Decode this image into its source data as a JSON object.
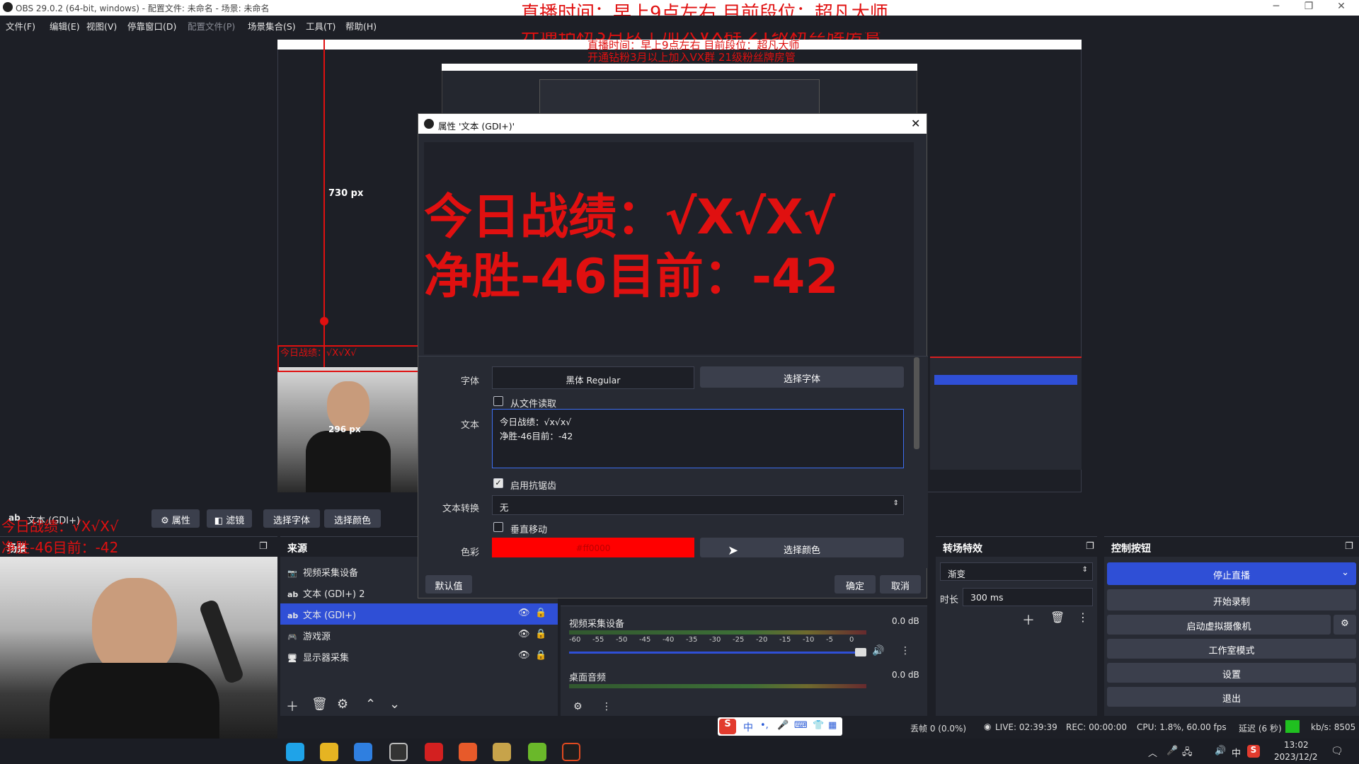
{
  "window": {
    "title": "OBS 29.0.2 (64-bit, windows) - 配置文件: 未命名 - 场景: 未命名",
    "minimize": "─",
    "maximize": "❐",
    "close": "✕"
  },
  "menu": {
    "file": "文件(F)",
    "edit": "编辑(E)",
    "view": "视图(V)",
    "docks": "停靠窗口(D)",
    "profile": "配置文件(P)",
    "scene_collection": "场景集合(S)",
    "tools": "工具(T)",
    "help": "帮助(H)"
  },
  "overlay": {
    "line1": "直播时间：早上9点左右  目前段位：超凡大师",
    "line2": "开通钻粉3月以上加入VX群  21级粉丝牌房管",
    "score_line1": "今日战绩：√X√X√",
    "score_line2": "净胜-46目前：-42"
  },
  "preview": {
    "height_label": "730 px",
    "width_label": "296 px"
  },
  "source_toolbar": {
    "selected_source": "文本 (GDI+)",
    "properties": "属性",
    "filters": "滤镜",
    "select_font": "选择字体",
    "select_color": "选择颜色"
  },
  "docks": {
    "scenes": "场景",
    "sources": "来源",
    "transitions": "转场特效",
    "controls": "控制按钮"
  },
  "sources": [
    {
      "name": "视频采集设备",
      "icon": "camera-icon",
      "selected": false
    },
    {
      "name": "文本 (GDI+) 2",
      "icon": "text-icon",
      "selected": false
    },
    {
      "name": "文本 (GDI+)",
      "icon": "text-icon",
      "selected": true
    },
    {
      "name": "游戏源",
      "icon": "gamepad-icon",
      "selected": false
    },
    {
      "name": "显示器采集",
      "icon": "monitor-icon",
      "selected": false
    }
  ],
  "mixer": {
    "ch1_name": "视频采集设备",
    "ch1_db": "0.0 dB",
    "ch2_name": "桌面音频",
    "ch2_db": "0.0 dB",
    "ticks": [
      "-60",
      "-55",
      "-50",
      "-45",
      "-40",
      "-35",
      "-30",
      "-25",
      "-20",
      "-15",
      "-10",
      "-5",
      "0"
    ]
  },
  "transitions": {
    "type": "渐变",
    "duration_label": "时长",
    "duration": "300 ms"
  },
  "controls": {
    "stop_stream": "停止直播",
    "start_record": "开始录制",
    "virtual_cam": "启动虚拟摄像机",
    "studio_mode": "工作室模式",
    "settings": "设置",
    "exit": "退出"
  },
  "status": {
    "dropped": "丢帧 0 (0.0%)",
    "live": "LIVE: 02:39:39",
    "rec": "REC: 00:00:00",
    "cpu": "CPU: 1.8%, 60.00 fps",
    "delay": "延迟 (6 秒)",
    "kbps": "kb/s: 8505"
  },
  "dialog": {
    "title": "属性 '文本 (GDI+)'",
    "preview_line1": "今日战绩：√X√X√",
    "preview_line2": "净胜-46目前：-42",
    "font_label": "字体",
    "font_value": "黑体 Regular",
    "select_font": "选择字体",
    "from_file": "从文件读取",
    "text_label": "文本",
    "text_line1": "今日战绩：√x√x√",
    "text_line2": "净胜-46目前：-42",
    "antialias": "启用抗锯齿",
    "transform_label": "文本转换",
    "transform_value": "无",
    "vertical": "垂直移动",
    "color_label": "色彩",
    "color_value": "#ff0000",
    "select_color": "选择颜色",
    "defaults": "默认值",
    "ok": "确定",
    "cancel": "取消"
  },
  "ime": {
    "lang": "中"
  },
  "clock": {
    "time": "13:02",
    "date": "2023/12/2"
  },
  "tray": {
    "ime": "中"
  },
  "colors": {
    "accent": "#2f4fd6",
    "red": "#e01010",
    "bg": "#1d1f26",
    "panel": "#272a33"
  }
}
